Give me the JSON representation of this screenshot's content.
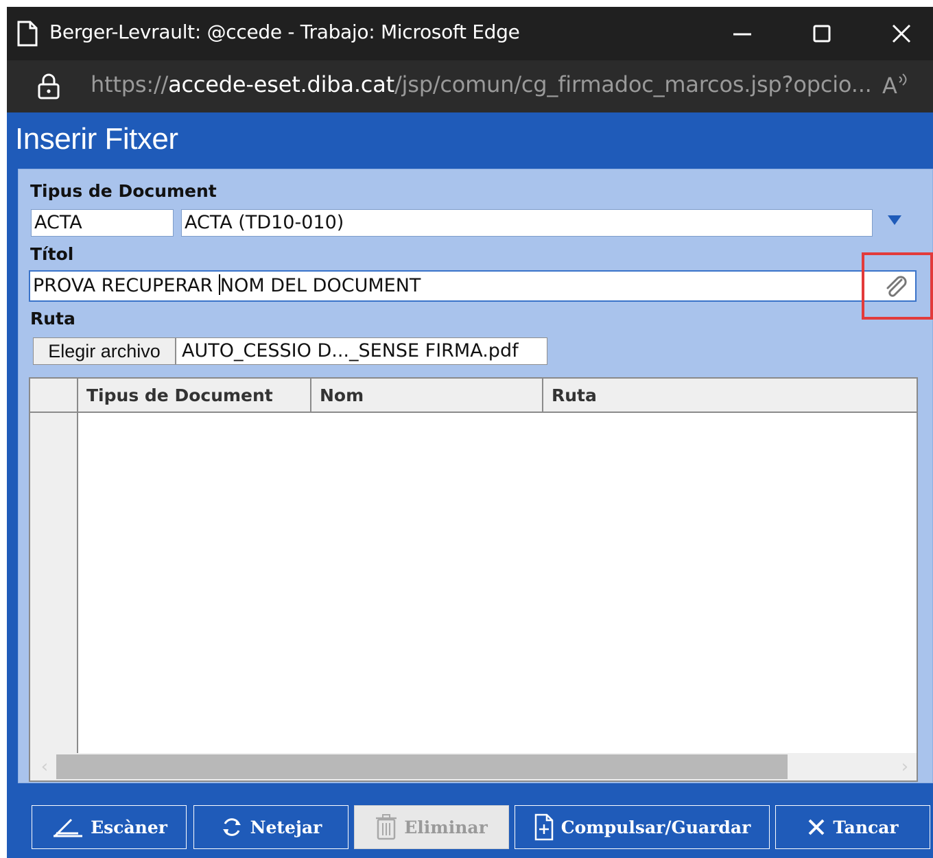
{
  "browser": {
    "window_title": "Berger-Levrault: @ccede - Trabajo: Microsoft Edge",
    "url_prefix": "https://",
    "url_host": "accede-eset.diba.cat",
    "url_path": "/jsp/comun/cg_firmadoc_marcos.jsp?opcio...",
    "read_aloud": "A"
  },
  "dialog": {
    "title": "Inserir Fitxer",
    "tipus_label": "Tipus de Document",
    "tipus_code": "ACTA",
    "tipus_desc": "ACTA (TD10-010)",
    "titol_label": "Títol",
    "titol_before_caret": "PROVA RECUPERAR ",
    "titol_after_caret": "NOM DEL DOCUMENT",
    "ruta_label": "Ruta",
    "file_button": "Elegir archivo",
    "file_name": "AUTO_CESSIO D..._SENSE FIRMA.pdf"
  },
  "grid": {
    "columns": [
      "Tipus de Document",
      "Nom",
      "Ruta"
    ]
  },
  "buttons": {
    "scan": "Escàner",
    "clear": "Netejar",
    "delete": "Eliminar",
    "save": "Compulsar/Guardar",
    "close": "Tancar"
  },
  "colors": {
    "dialog_blue": "#1f5bb9",
    "panel_blue": "#a9c3ec",
    "highlight_red": "#e23b3b"
  }
}
